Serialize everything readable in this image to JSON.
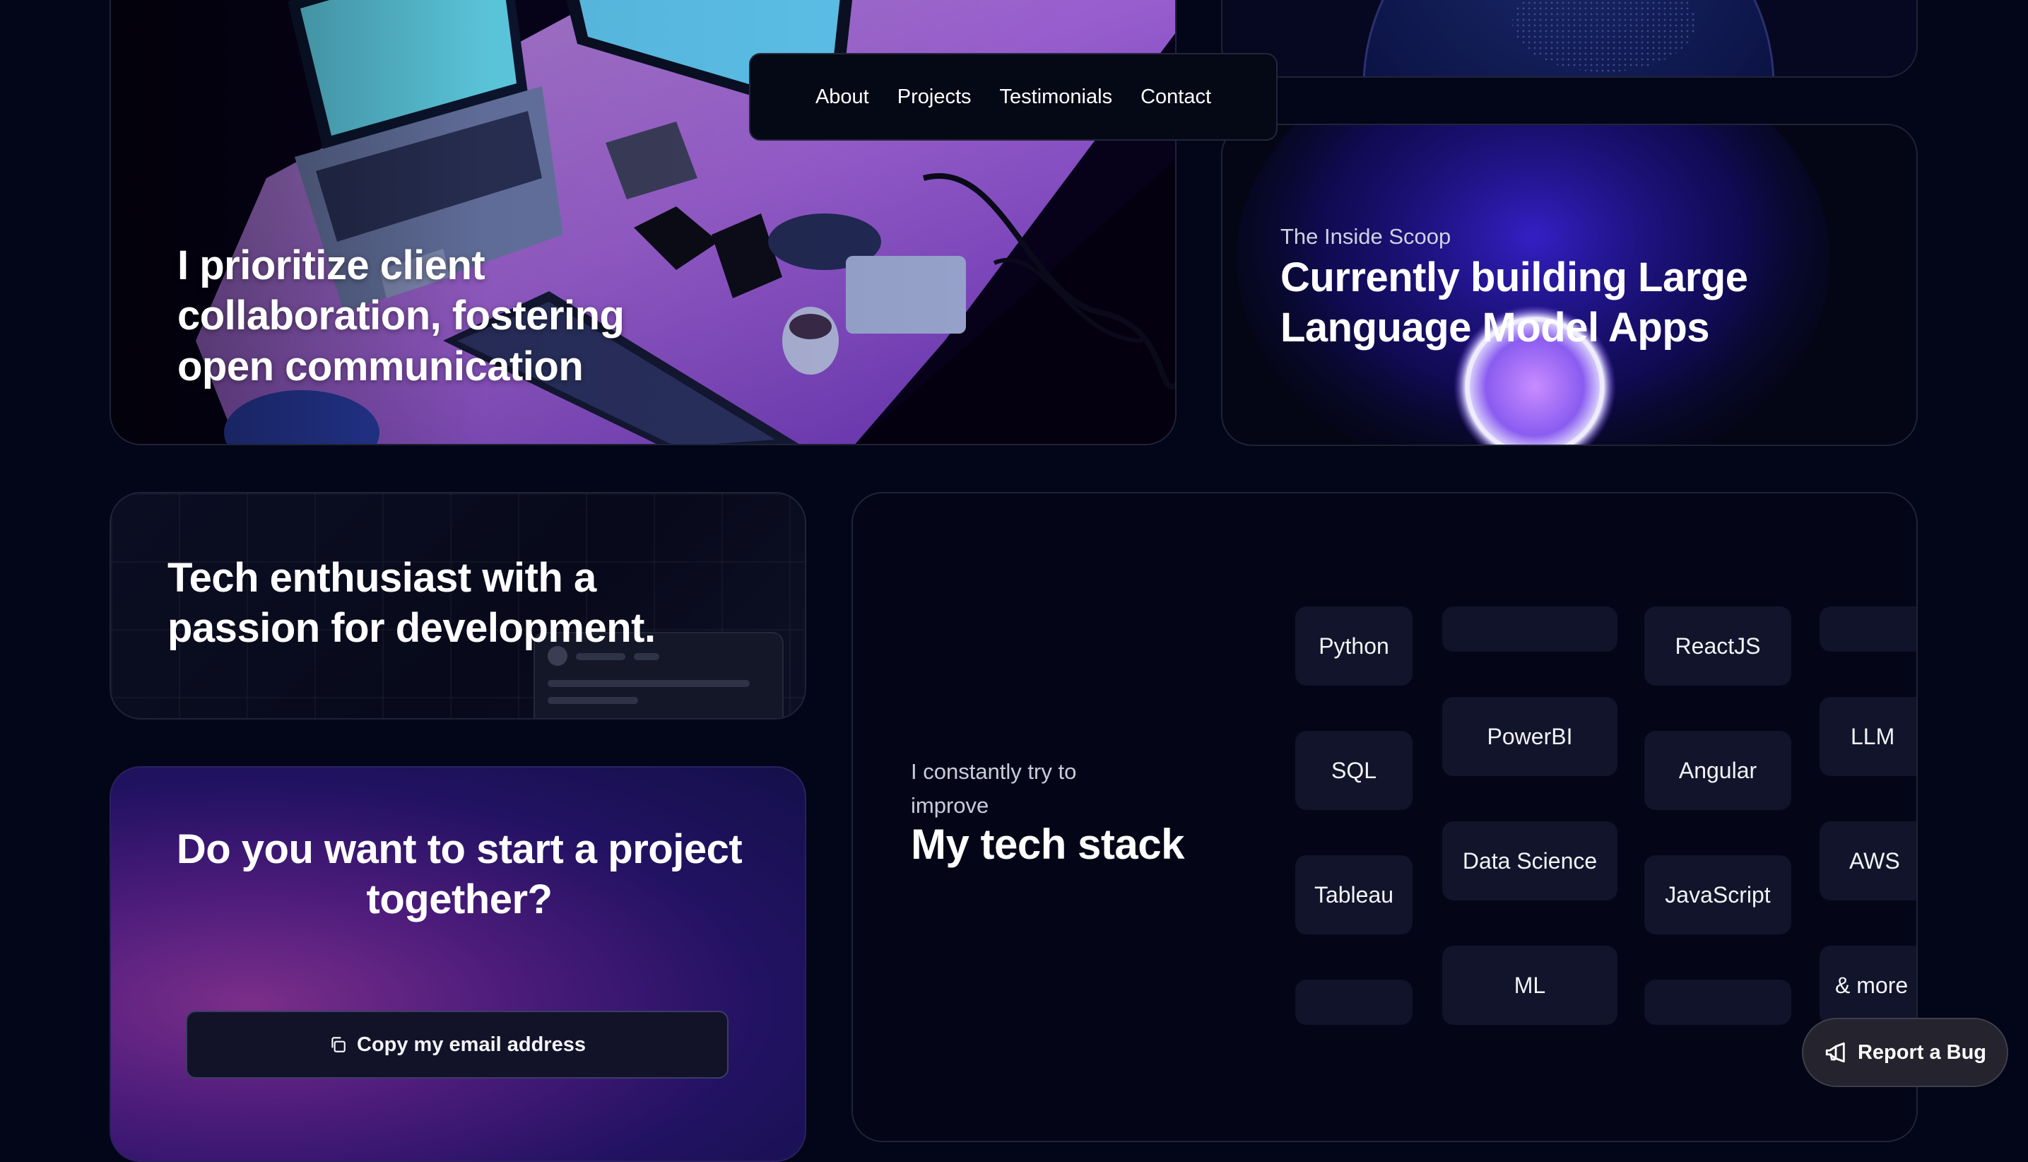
{
  "nav": {
    "items": [
      "About",
      "Projects",
      "Testimonials",
      "Contact"
    ]
  },
  "photo_card": {
    "heading": "I prioritize client collaboration, fostering open communication"
  },
  "scoop_card": {
    "subtitle": "The Inside Scoop",
    "heading": "Currently building Large Language Model Apps"
  },
  "tech_card": {
    "heading": "Tech enthusiast with a passion for development."
  },
  "cta_card": {
    "heading": "Do you want to start a project together?",
    "button_label": "Copy my email address"
  },
  "stack_card": {
    "subtitle": "I constantly try to improve",
    "heading": "My tech stack",
    "chips": {
      "col1": [
        "Python",
        "SQL",
        "Tableau",
        ""
      ],
      "col2": [
        "",
        "PowerBI",
        "Data Science",
        "ML"
      ],
      "col3": [
        "ReactJS",
        "Angular",
        "JavaScript",
        ""
      ],
      "col4": [
        "",
        "LLM",
        "AWS",
        "& more"
      ]
    }
  },
  "report_bug": {
    "label": "Report a Bug"
  },
  "colors": {
    "background": "#030619",
    "card_border": "#1f2336",
    "chip_bg": "#11142a",
    "accent_purple": "#7b2e8a"
  }
}
